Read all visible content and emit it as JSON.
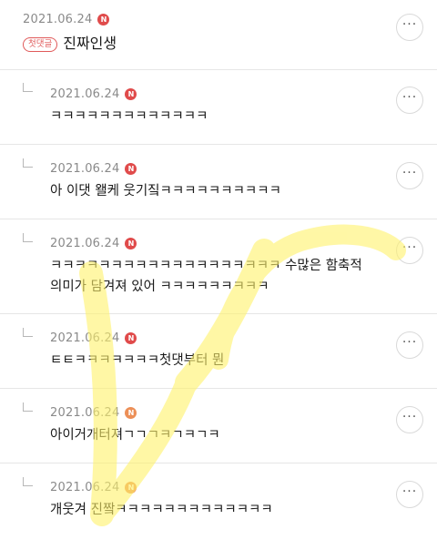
{
  "comments": [
    {
      "date": "2021.06.24",
      "badge": "N",
      "tag": "첫댓글",
      "text": "진짜인생"
    },
    {
      "date": "2021.06.24",
      "badge": "N",
      "text": "ㅋㅋㅋㅋㅋㅋㅋㅋㅋㅋㅋㅋㅋ"
    },
    {
      "date": "2021.06.24",
      "badge": "N",
      "text": "아 이댓 왤케 웃기짘ㅋㅋㅋㅋㅋㅋㅋㅋㅋㅋ"
    },
    {
      "date": "2021.06.24",
      "badge": "N",
      "text": "ㅋㅋㅋㅋㅋㅋㅋㅋㅋㅋㅋㅋㅋㅋㅋㅋㅋㅋㅋ 수많은 함축적",
      "text2": "의미가 담겨져 있어 ㅋㅋㅋㅋㅋㅋㅋㅋㅋ"
    },
    {
      "date": "2021.06.24",
      "badge": "N",
      "text": "ㅌㅌㅋㅋㅋㅋㅋㅋㅋ첫댓부터 뭔"
    },
    {
      "date": "2021.06.24",
      "badge": "N",
      "text": "아이거개터져ㄱㄱㄱㅋㄱㅋㄱㅋ"
    },
    {
      "date": "2021.06.24",
      "badge": "N",
      "text": "개웃겨 진짴ㅋㅋㅋㅋㅋㅋㅋㅋㅋㅋㅋㅋㅋ"
    }
  ],
  "more_label": "···",
  "colors": {
    "badge_red": "#e04b4b",
    "badge_orange": "#ec8f57",
    "watermark": "#fff26a"
  }
}
